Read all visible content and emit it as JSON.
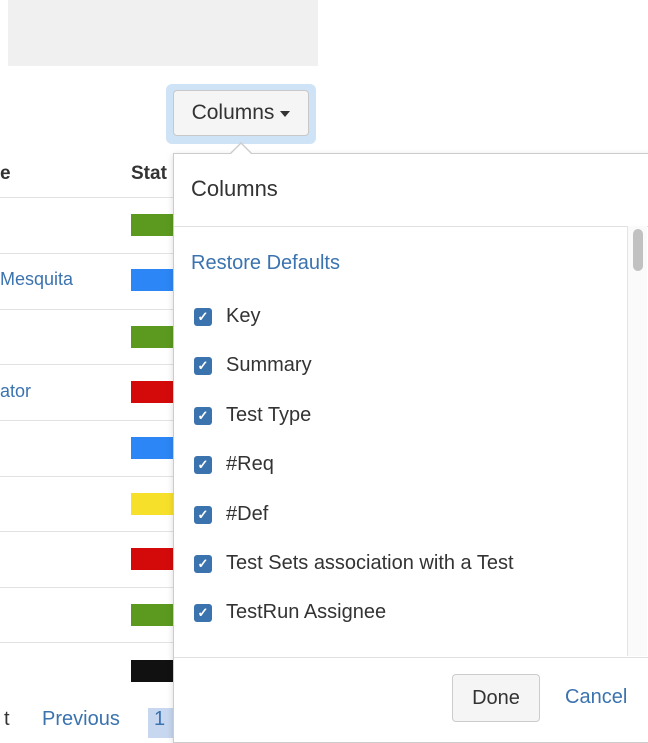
{
  "toolbar": {
    "columns_button_label": "Columns"
  },
  "table": {
    "header_fragments": [
      "e",
      "Stat"
    ],
    "name_fragments": [
      "Mesquita",
      "ator"
    ],
    "status_colors": [
      "#5b9a1f",
      "#2d86f5",
      "#5b9a1f",
      "#d40a0a",
      "#2d86f5",
      "#f7e02a",
      "#d40a0a",
      "#5b9a1f",
      "#111111"
    ]
  },
  "pager": {
    "prev_fragment": "t",
    "previous": "Previous",
    "page": "1"
  },
  "panel": {
    "title": "Columns",
    "restore_defaults": "Restore Defaults",
    "options": [
      {
        "label": "Key",
        "checked": true
      },
      {
        "label": "Summary",
        "checked": true
      },
      {
        "label": "Test Type",
        "checked": true
      },
      {
        "label": "#Req",
        "checked": true
      },
      {
        "label": "#Def",
        "checked": true
      },
      {
        "label": "Test Sets association with a Test",
        "checked": true
      },
      {
        "label": "TestRun Assignee",
        "checked": true
      }
    ],
    "done": "Done",
    "cancel": "Cancel"
  }
}
